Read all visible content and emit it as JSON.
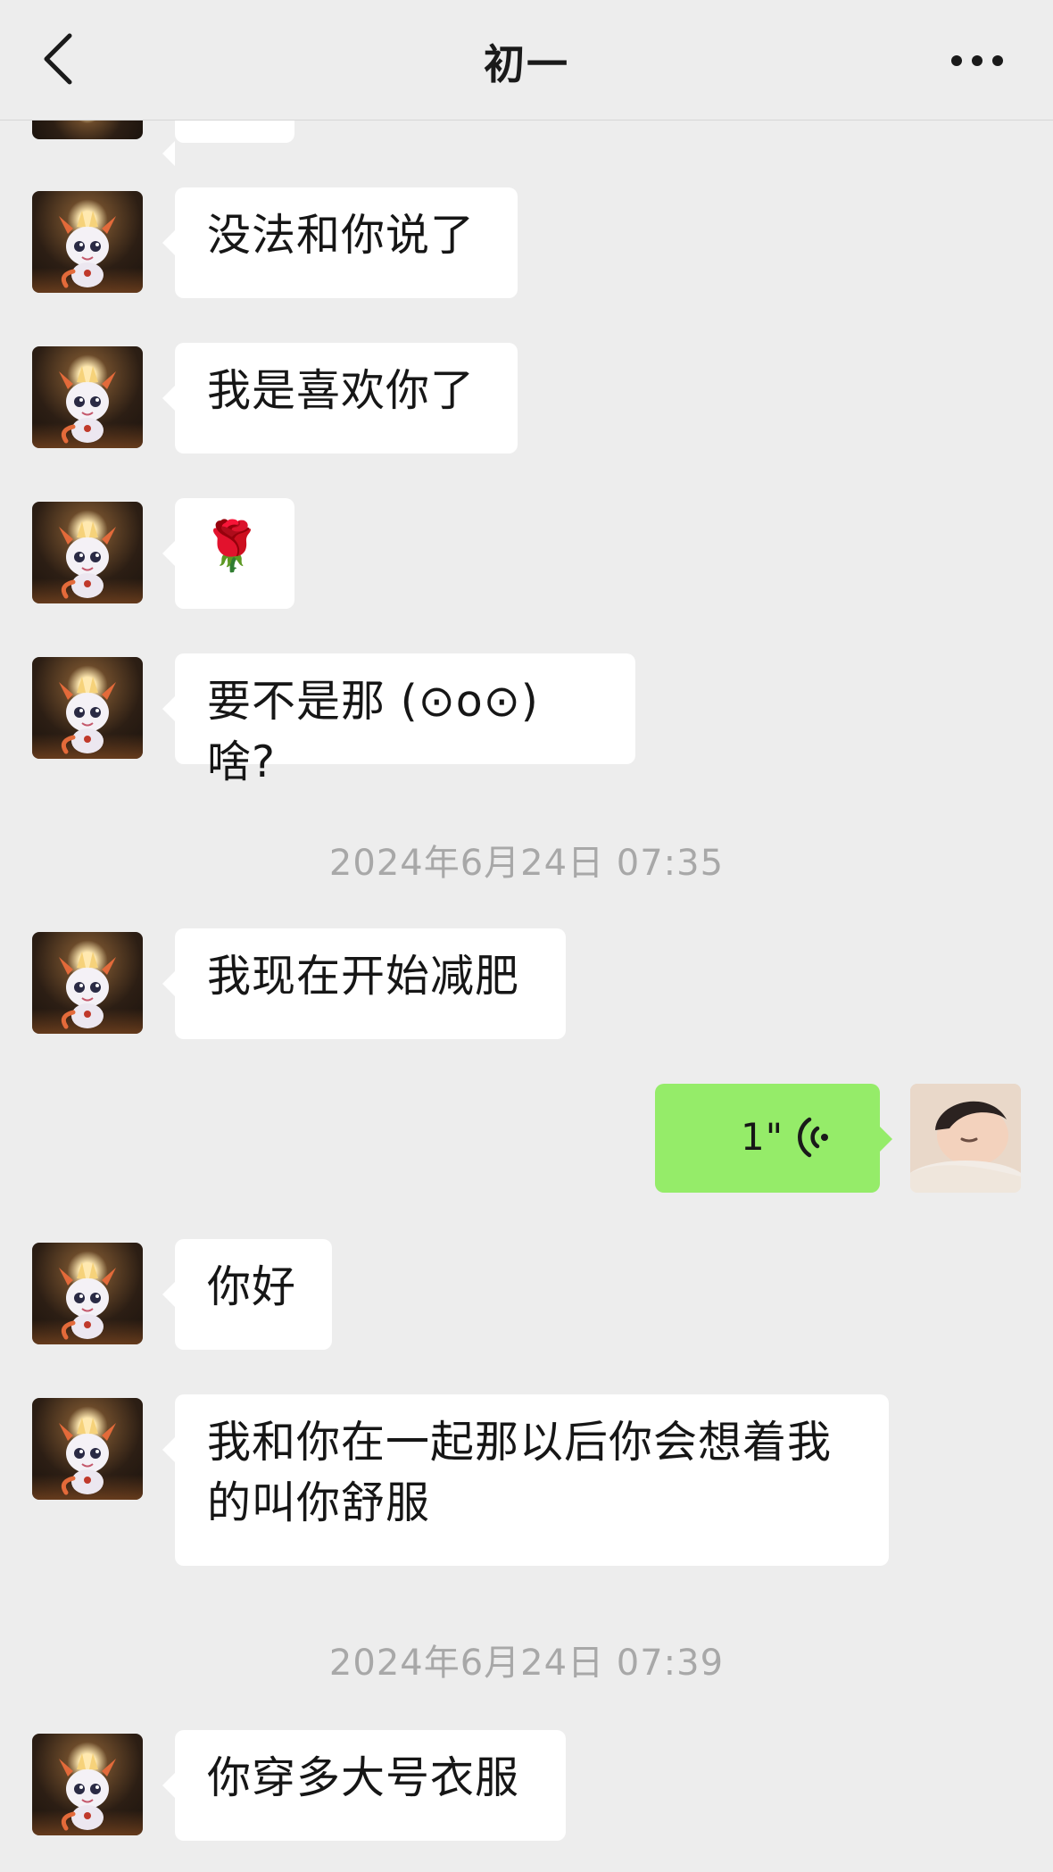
{
  "header": {
    "title": "初一"
  },
  "messages": [
    {
      "side": "left",
      "text": "没法和你说了"
    },
    {
      "side": "left",
      "text": "我是喜欢你了"
    },
    {
      "side": "left",
      "text": "🌹"
    },
    {
      "side": "left",
      "text": "要不是那 (⊙o⊙) 啥?"
    },
    {
      "side": "left",
      "text": "我现在开始减肥"
    },
    {
      "side": "right",
      "type": "voice",
      "duration": "1\""
    },
    {
      "side": "left",
      "text": "你好"
    },
    {
      "side": "left",
      "text": "我和你在一起那以后你会想着我的叫你舒服"
    },
    {
      "side": "left",
      "text": "你穿多大号衣服"
    }
  ],
  "timestamps": [
    "2024年6月24日 07:35",
    "2024年6月24日 07:39"
  ],
  "icons": {
    "back": "chevron-left-icon",
    "more": "more-dots-icon",
    "voice": "voice-wave-icon"
  },
  "colors": {
    "background": "#ededed",
    "bubble_in": "#ffffff",
    "bubble_out": "#95ec69",
    "timestamp": "#a8a8a8"
  }
}
